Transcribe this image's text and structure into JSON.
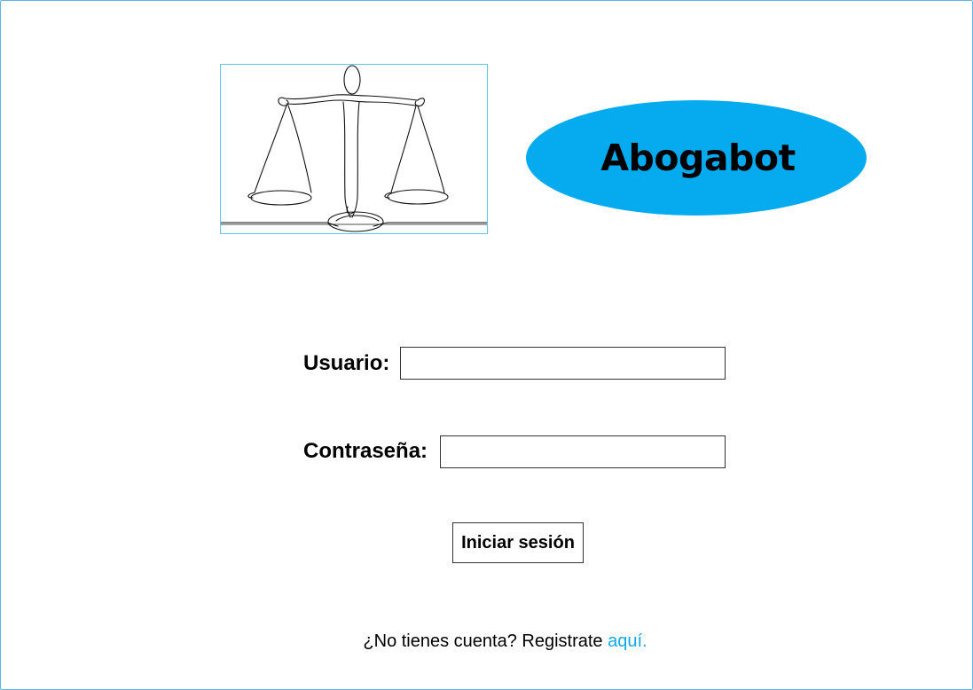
{
  "app": {
    "brand_name": "Abogabot",
    "brand_color": "#06abef",
    "link_color": "#12a8e6"
  },
  "logo": {
    "icon": "scales-of-justice-icon"
  },
  "form": {
    "username_label": "Usuario:",
    "username_value": "",
    "password_label": "Contraseña:",
    "password_value": "",
    "submit_label": "Iniciar sesión"
  },
  "register": {
    "prompt": "¿No tienes cuenta? Registrate ",
    "link_text": "aquí."
  }
}
